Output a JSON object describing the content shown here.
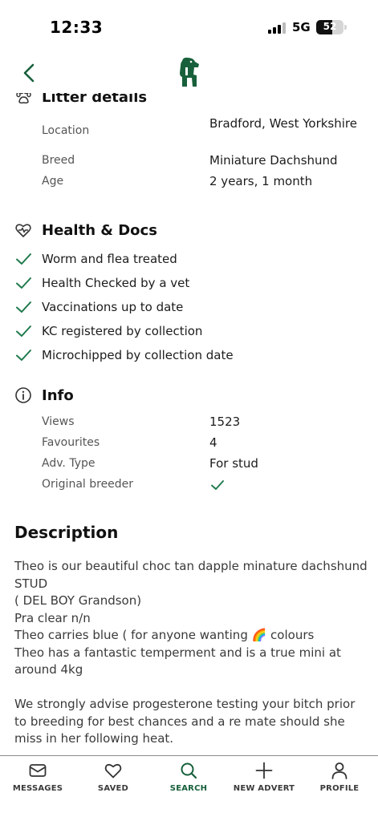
{
  "status_bar": {
    "time": "12:33",
    "network": "5G",
    "battery": "52"
  },
  "nav": {
    "back_icon": "chevron-left-icon",
    "logo_icon": "brand-logo-icon"
  },
  "colors": {
    "brand_green": "#17603b",
    "check_green": "#1f7a4d",
    "text": "#1c1c1c",
    "muted": "#555555"
  },
  "litter": {
    "title": "Litter details",
    "icon": "paw-icon",
    "rows": [
      {
        "label": "Location",
        "value": "Bradford, West Yorkshire"
      },
      {
        "label": "Breed",
        "value": "Miniature Dachshund"
      },
      {
        "label": "Age",
        "value": "2 years, 1 month"
      }
    ]
  },
  "health": {
    "title": "Health & Docs",
    "icon": "heart-pulse-icon",
    "items": [
      "Worm and flea treated",
      "Health Checked by a vet",
      "Vaccinations up to date",
      "KC registered by collection",
      "Microchipped by collection date"
    ]
  },
  "info": {
    "title": "Info",
    "icon": "info-icon",
    "rows": [
      {
        "label": "Views",
        "value": "1523"
      },
      {
        "label": "Favourites",
        "value": "4"
      },
      {
        "label": "Adv. Type",
        "value": "For stud"
      },
      {
        "label": "Original breeder",
        "value": ""
      }
    ]
  },
  "description": {
    "title": "Description",
    "text": "Theo is our beautiful choc tan dapple minature dachshund STUD\n( DEL BOY Grandson)\nPra clear n/n\nTheo carries blue ( for anyone wanting 🌈 colours\nTheo has a fantastic temperment and is a true mini at around 4kg\n\nWe strongly advise progesterone testing your bitch prior to breeding for best chances and a re mate should she miss in her following heat."
  },
  "tabs": [
    {
      "label": "MESSAGES",
      "icon": "envelope-icon",
      "active": false
    },
    {
      "label": "SAVED",
      "icon": "heart-icon",
      "active": false
    },
    {
      "label": "SEARCH",
      "icon": "search-icon",
      "active": true
    },
    {
      "label": "NEW ADVERT",
      "icon": "plus-icon",
      "active": false
    },
    {
      "label": "PROFILE",
      "icon": "user-icon",
      "active": false
    }
  ]
}
